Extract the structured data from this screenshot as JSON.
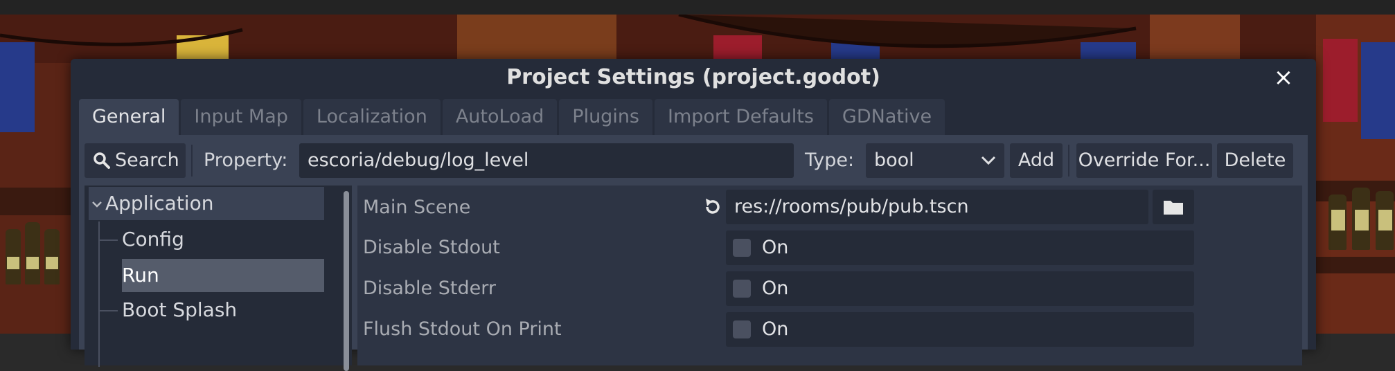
{
  "dialog": {
    "title": "Project Settings (project.godot)",
    "close_icon": "×"
  },
  "tabs": [
    {
      "label": "General",
      "active": true
    },
    {
      "label": "Input Map",
      "active": false
    },
    {
      "label": "Localization",
      "active": false
    },
    {
      "label": "AutoLoad",
      "active": false
    },
    {
      "label": "Plugins",
      "active": false
    },
    {
      "label": "Import Defaults",
      "active": false
    },
    {
      "label": "GDNative",
      "active": false
    }
  ],
  "toolbar": {
    "search_label": "Search",
    "search_icon": "search-icon",
    "property_label": "Property:",
    "property_value": "escoria/debug/log_level",
    "type_label": "Type:",
    "type_value": "bool",
    "add_label": "Add",
    "override_label": "Override For...",
    "delete_label": "Delete"
  },
  "tree": {
    "category": "Application",
    "items": [
      {
        "label": "Config",
        "selected": false
      },
      {
        "label": "Run",
        "selected": true
      },
      {
        "label": "Boot Splash",
        "selected": false
      }
    ]
  },
  "properties": [
    {
      "label": "Main Scene",
      "value": "res://rooms/pub/pub.tscn",
      "kind": "file"
    },
    {
      "label": "Disable Stdout",
      "value": "On",
      "kind": "checkbox",
      "checked": false
    },
    {
      "label": "Disable Stderr",
      "value": "On",
      "kind": "checkbox",
      "checked": false
    },
    {
      "label": "Flush Stdout On Print",
      "value": "On",
      "kind": "checkbox",
      "checked": false
    }
  ],
  "colors": {
    "dialog_bg": "#252b39",
    "panel_bg": "#3a4254",
    "selected_row": "#555c6b"
  }
}
